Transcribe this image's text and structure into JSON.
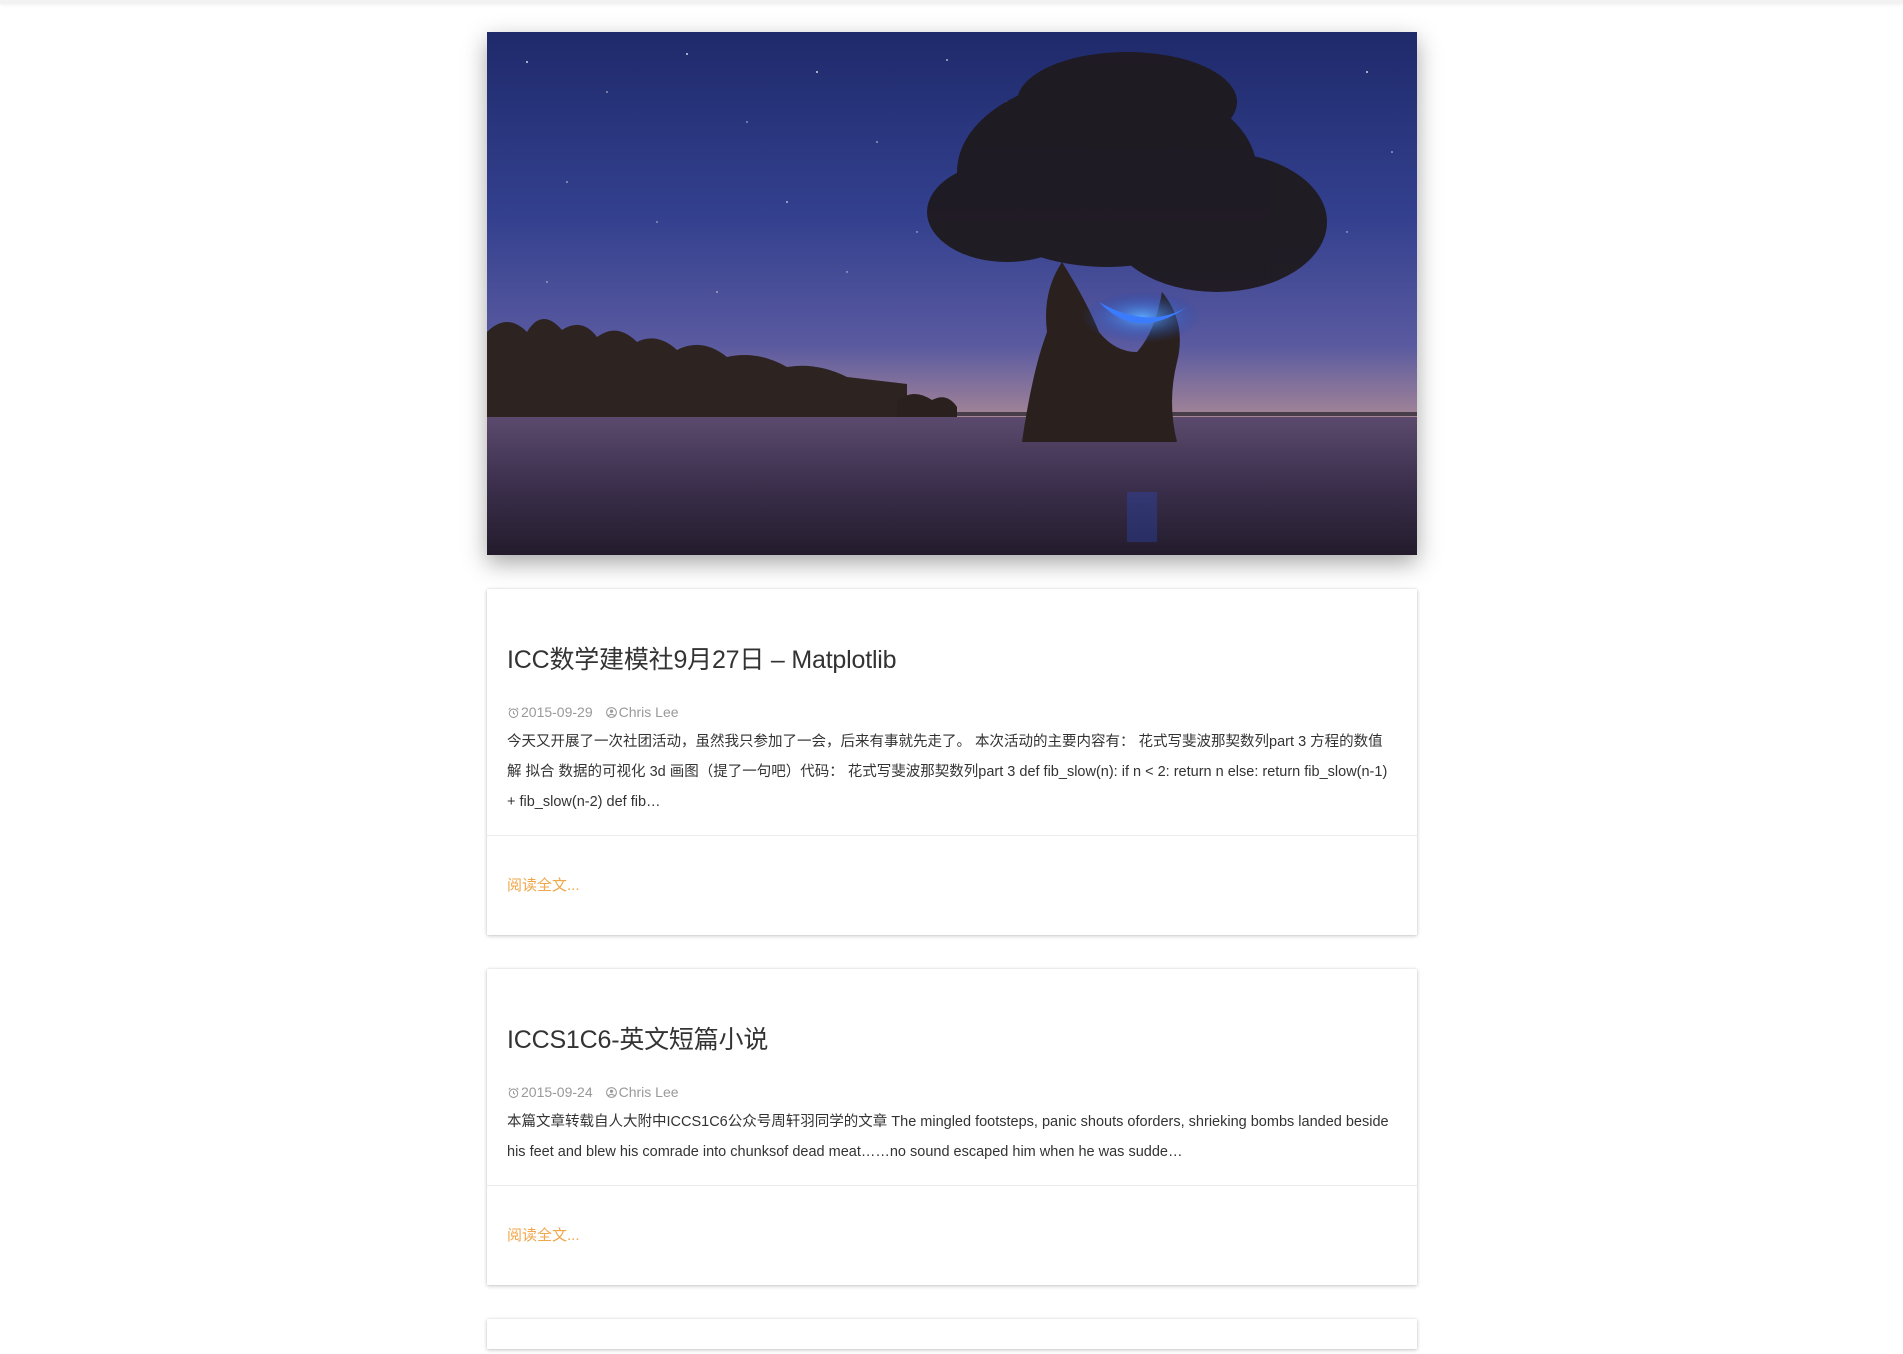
{
  "hero": {
    "alt_icon": "hero-landscape-image"
  },
  "posts": [
    {
      "title": "ICC数学建模社9月27日 – Matplotlib",
      "date": "2015-09-29",
      "author": "Chris Lee",
      "excerpt": "今天又开展了一次社团活动，虽然我只参加了一会，后来有事就先走了。 本次活动的主要内容有： 花式写斐波那契数列part 3 方程的数值解 拟合 数据的可视化 3d 画图（提了一句吧）代码： 花式写斐波那契数列part 3 def fib_slow(n): if n < 2: return n else: return fib_slow(n-1) + fib_slow(n-2) def fib…",
      "read_more": "阅读全文..."
    },
    {
      "title": "ICCS1C6-英文短篇小说",
      "date": "2015-09-24",
      "author": "Chris Lee",
      "excerpt": "本篇文章转载自人大附中ICCS1C6公众号周轩羽同学的文章 The mingled footsteps, panic shouts oforders, shrieking bombs landed beside his feet and blew his comrade into chunksof dead meat……no sound escaped him when he was sudde…",
      "read_more": "阅读全文..."
    }
  ],
  "colors": {
    "accent": "#f0a64a",
    "meta": "#999999",
    "text": "#333333"
  }
}
